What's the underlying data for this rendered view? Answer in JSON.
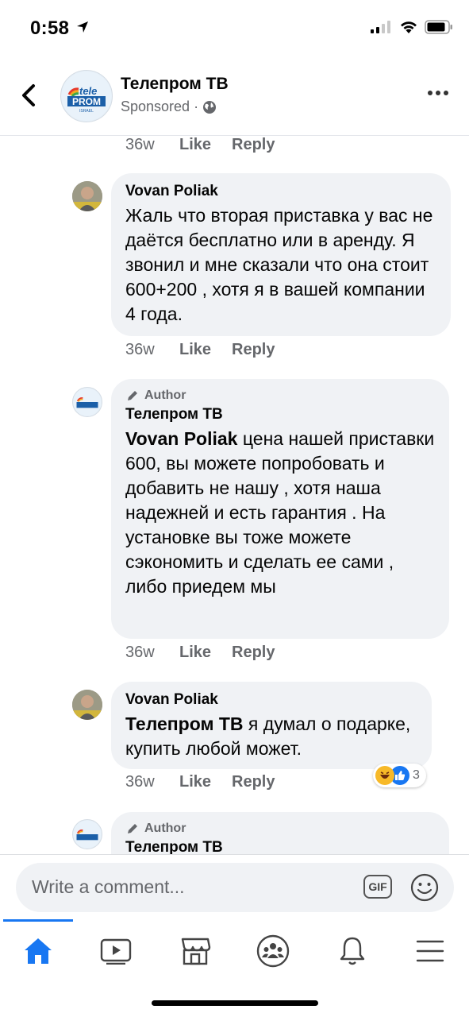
{
  "status_bar": {
    "time": "0:58"
  },
  "header": {
    "page_name": "Телепром ТВ",
    "sponsored": "Sponsored ·"
  },
  "logo": {
    "text_top": "tele",
    "text_main": "PROM",
    "text_sub": "ISRAEL"
  },
  "comments": [
    {
      "time": "36w",
      "like": "Like",
      "reply": "Reply"
    },
    {
      "author": "Vovan Poliak",
      "text": "Жаль что вторая приставка у вас не даётся бесплатно или в аренду.  Я звонил и мне сказали что она стоит 600+200 , хотя я в вашей компании 4 года.",
      "time": "36w",
      "like": "Like",
      "reply": "Reply"
    },
    {
      "badge": "Author",
      "author": "Телепром ТВ",
      "mention": "Vovan Poliak",
      "text": "  цена нашей приставки 600, вы можете попробовать и добавить не нашу , хотя наша надежней и есть гарантия . На установке вы тоже можете сэкономить и сделать ее сами , либо приедем мы",
      "time": "36w",
      "like": "Like",
      "reply": "Reply"
    },
    {
      "author": "Vovan Poliak",
      "mention": "Телепром ТВ",
      "text": " я думал о подарке, купить любой может.",
      "time": "36w",
      "like": "Like",
      "reply": "Reply",
      "reaction_count": "3"
    },
    {
      "badge": "Author",
      "author": "Телепром ТВ"
    }
  ],
  "composer": {
    "placeholder": "Write a comment...",
    "gif": "GIF"
  },
  "tabs": [
    "home-icon",
    "video-icon",
    "marketplace-icon",
    "groups-icon",
    "notifications-icon",
    "menu-icon"
  ],
  "colors": {
    "accent": "#1877f2",
    "bubble": "#f0f2f5",
    "secondary_text": "#65676b"
  }
}
